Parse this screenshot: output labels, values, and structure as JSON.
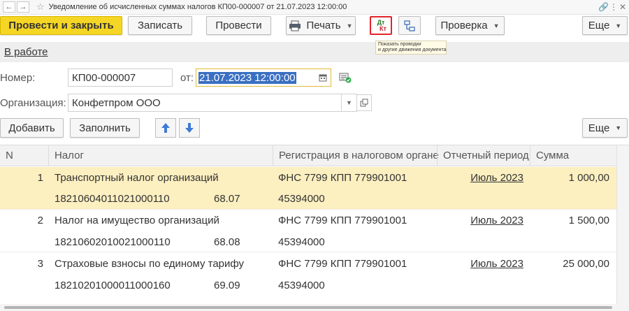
{
  "window": {
    "title": "Уведомление об исчисленных суммах налогов КП00-000007 от 21.07.2023 12:00:00",
    "back_glyph": "←",
    "forward_glyph": "→",
    "star_glyph": "☆",
    "link_glyph": "🔗",
    "more_glyph": "⋮",
    "close_glyph": "✕"
  },
  "toolbar": {
    "post_and_close": "Провести и закрыть",
    "save": "Записать",
    "post": "Провести",
    "print": "Печать",
    "dtkt_dt": "Дт",
    "dtkt_kt": "Кт",
    "check": "Проверка",
    "more": "Еще"
  },
  "tooltip": {
    "line1": "Показать проводки",
    "line2": "и другие движения документа"
  },
  "status": {
    "label": "В работе"
  },
  "form": {
    "number_label": "Номер:",
    "number_value": "КП00-000007",
    "date_label": "от:",
    "date_value": "21.07.2023 12:00:00",
    "org_label": "Организация:",
    "org_value": "Конфетпром ООО"
  },
  "table_toolbar": {
    "add": "Добавить",
    "fill": "Заполнить",
    "more": "Еще"
  },
  "table": {
    "columns": [
      "N",
      "Налог",
      "Регистрация в налоговом органе",
      "Отчетный период",
      "Сумма"
    ],
    "rows": [
      {
        "n": "1",
        "tax": "Транспортный налог организаций",
        "kbk": "18210604011021000110",
        "account": "68.07",
        "registration": "ФНС 7799 КПП 779901001",
        "oktmo": "45394000",
        "period": "Июль 2023",
        "amount": "1 000,00"
      },
      {
        "n": "2",
        "tax": "Налог на имущество организаций",
        "kbk": "18210602010021000110",
        "account": "68.08",
        "registration": "ФНС 7799 КПП 779901001",
        "oktmo": "45394000",
        "period": "Июль 2023",
        "amount": "1 500,00"
      },
      {
        "n": "3",
        "tax": "Страховые взносы по единому тарифу",
        "kbk": "18210201000011000160",
        "account": "69.09",
        "registration": "ФНС 7799 КПП 779901001",
        "oktmo": "45394000",
        "period": "Июль 2023",
        "amount": "25 000,00"
      }
    ]
  },
  "colors": {
    "primary_button": "#f6d624",
    "selected_row": "#fcefc0",
    "date_highlight": "#3a6fc2",
    "dtkt_border": "#e0242b"
  }
}
